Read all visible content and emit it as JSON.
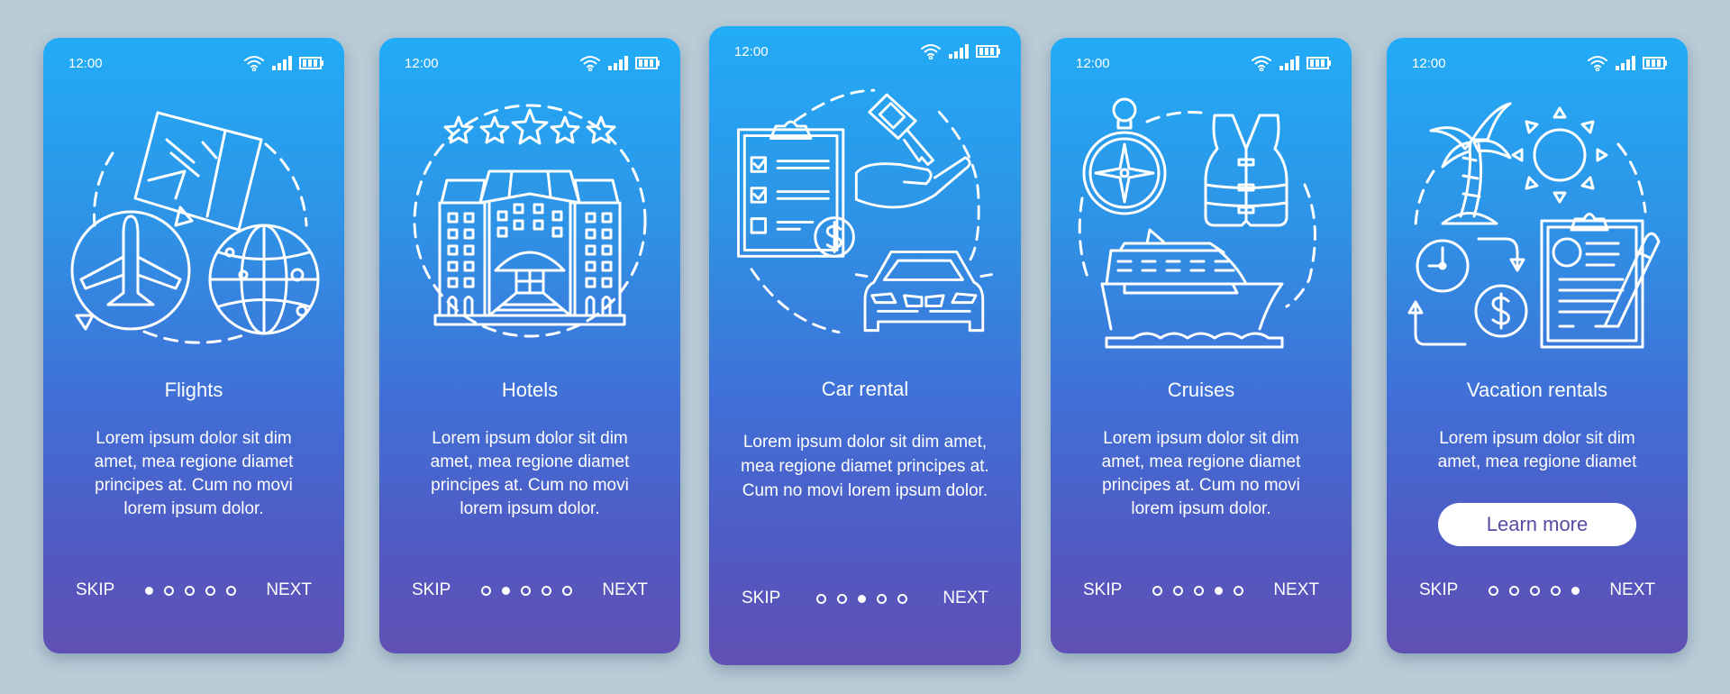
{
  "colors": {
    "background": "#b9ccd7",
    "gradient_top": "#22acf7",
    "gradient_bottom": "#6150b4",
    "button_text": "#5a4aa5"
  },
  "screens": [
    {
      "time": "12:00",
      "status_icons": [
        "wifi-icon",
        "signal-icon",
        "battery-icon"
      ],
      "illustration": "flights-illustration",
      "title": "Flights",
      "description": "Lorem ipsum dolor sit dim amet, mea regione diamet principes at. Cum no movi lorem ipsum dolor.",
      "skip_label": "SKIP",
      "next_label": "NEXT",
      "page_indicator": {
        "current": 1,
        "total": 5
      }
    },
    {
      "time": "12:00",
      "status_icons": [
        "wifi-icon",
        "signal-icon",
        "battery-icon"
      ],
      "illustration": "hotels-illustration",
      "title": "Hotels",
      "description": "Lorem ipsum dolor sit dim amet, mea regione diamet principes at. Cum no movi lorem ipsum dolor.",
      "skip_label": "SKIP",
      "next_label": "NEXT",
      "page_indicator": {
        "current": 2,
        "total": 5
      }
    },
    {
      "time": "12:00",
      "status_icons": [
        "wifi-icon",
        "signal-icon",
        "battery-icon"
      ],
      "illustration": "car-rental-illustration",
      "title": "Car rental",
      "description": "Lorem ipsum dolor sit dim amet, mea regione diamet principes at. Cum no movi lorem ipsum dolor.",
      "skip_label": "SKIP",
      "next_label": "NEXT",
      "page_indicator": {
        "current": 3,
        "total": 5
      }
    },
    {
      "time": "12:00",
      "status_icons": [
        "wifi-icon",
        "signal-icon",
        "battery-icon"
      ],
      "illustration": "cruises-illustration",
      "title": "Cruises",
      "description": "Lorem ipsum dolor sit dim amet, mea regione diamet principes at. Cum no movi lorem ipsum dolor.",
      "skip_label": "SKIP",
      "next_label": "NEXT",
      "page_indicator": {
        "current": 4,
        "total": 5
      }
    },
    {
      "time": "12:00",
      "status_icons": [
        "wifi-icon",
        "signal-icon",
        "battery-icon"
      ],
      "illustration": "vacation-rentals-illustration",
      "title": "Vacation rentals",
      "description": "Lorem ipsum dolor sit dim amet, mea regione diamet",
      "button_label": "Learn more",
      "skip_label": "SKIP",
      "next_label": "NEXT",
      "page_indicator": {
        "current": 5,
        "total": 5
      }
    }
  ]
}
